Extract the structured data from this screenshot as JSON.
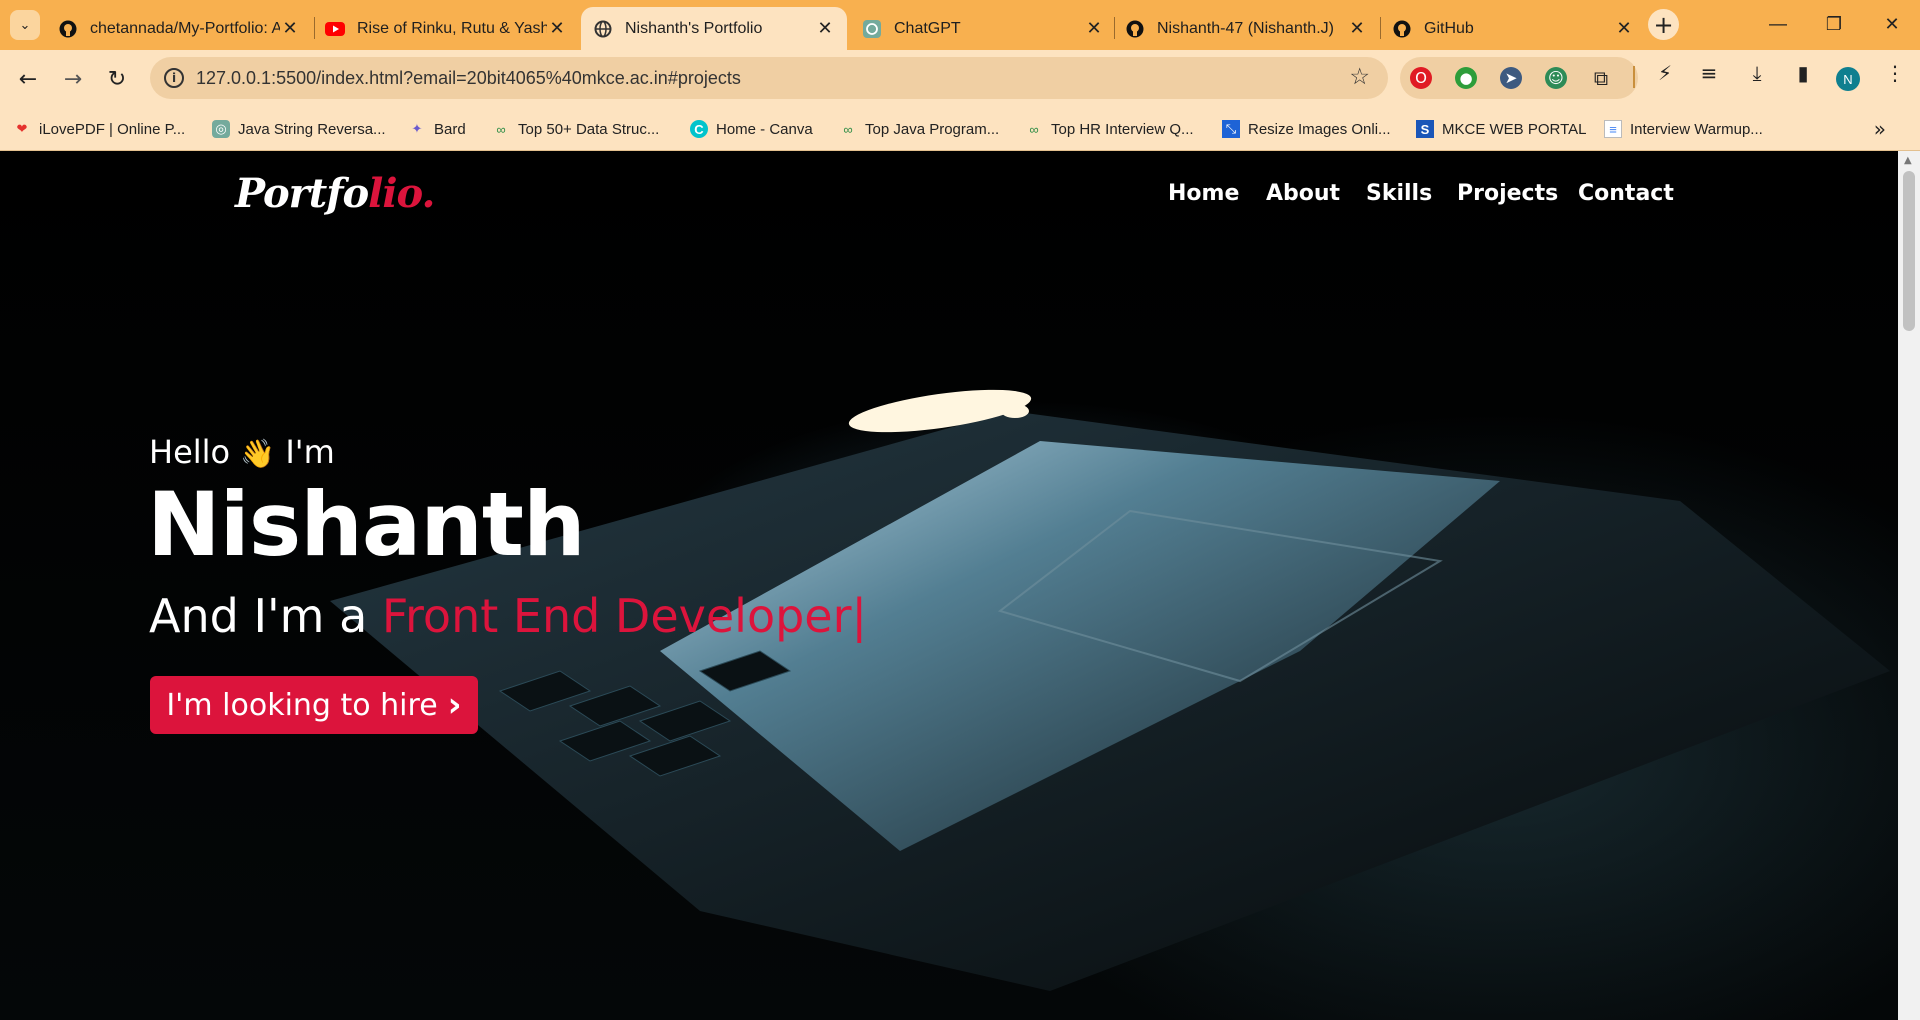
{
  "browser": {
    "tabs": [
      {
        "title": "chetannada/My-Portfolio: A p",
        "icon": "github-icon"
      },
      {
        "title": "Rise of Rinku, Rutu & Yashasv",
        "icon": "youtube-icon"
      },
      {
        "title": "Nishanth's Portfolio",
        "icon": "globe-icon",
        "active": true
      },
      {
        "title": "ChatGPT",
        "icon": "chatgpt-icon"
      },
      {
        "title": "Nishanth-47 (Nishanth.J)",
        "icon": "github-icon"
      },
      {
        "title": "GitHub",
        "icon": "github-icon"
      }
    ],
    "close_glyph": "✕",
    "new_tab_glyph": "+",
    "url": "127.0.0.1:5500/index.html?email=20bit4065%40mkce.ac.in#projects",
    "profile_initial": "N",
    "bookmarks": [
      {
        "label": "iLovePDF | Online P...",
        "icon": "heart-icon"
      },
      {
        "label": "Java String Reversa...",
        "icon": "chatgpt-icon"
      },
      {
        "label": "Bard",
        "icon": "sparkle-icon"
      },
      {
        "label": "Top 50+ Data Struc...",
        "icon": "gfg-icon"
      },
      {
        "label": "Home - Canva",
        "icon": "canva-icon"
      },
      {
        "label": "Top Java Program...",
        "icon": "gfg-icon"
      },
      {
        "label": "Top HR Interview Q...",
        "icon": "gfg-icon"
      },
      {
        "label": "Resize Images Onli...",
        "icon": "resize-icon"
      },
      {
        "label": "MKCE WEB PORTAL",
        "icon": "s-icon"
      },
      {
        "label": "Interview Warmup...",
        "icon": "doc-icon"
      }
    ]
  },
  "site": {
    "logo_main": "Portfo",
    "logo_accent": "lio.",
    "nav": [
      "Home",
      "About",
      "Skills",
      "Projects",
      "Contact"
    ],
    "hero": {
      "greeting_start": "Hello",
      "wave": "👋",
      "greeting_end": "I'm",
      "name": "Nishanth",
      "role_prefix": "And I'm a",
      "role_typed": "Front End Developer|",
      "cta_label": "I'm looking to hire",
      "cta_icon": "›"
    },
    "colors": {
      "accent": "#dc143c",
      "background": "#000000",
      "text": "#ffffff"
    }
  }
}
